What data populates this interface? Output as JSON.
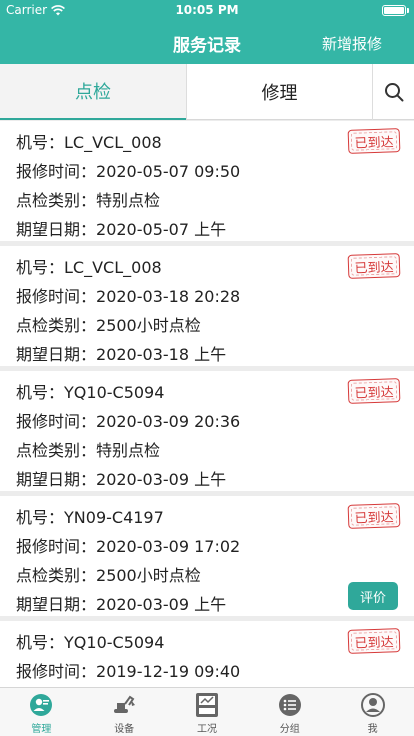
{
  "status_bar": {
    "carrier": "Carrier",
    "time": "10:05 PM"
  },
  "nav": {
    "title": "服务记录",
    "right_button": "新增报修"
  },
  "tabs": [
    {
      "label": "点检",
      "active": true
    },
    {
      "label": "修理",
      "active": false
    }
  ],
  "labels": {
    "machine": "机号：",
    "report_time": "报修时间：",
    "inspect_type": "点检类别：",
    "expected_date": "期望日期："
  },
  "records": [
    {
      "machine": "LC_VCL_008",
      "report_time": "2020-05-07 09:50",
      "inspect_type": "特别点检",
      "expected_date": "2020-05-07  上午",
      "stamp": "已到达"
    },
    {
      "machine": "LC_VCL_008",
      "report_time": "2020-03-18 20:28",
      "inspect_type": "2500小时点检",
      "expected_date": "2020-03-18  上午",
      "stamp": "已到达"
    },
    {
      "machine": "YQ10-C5094",
      "report_time": "2020-03-09 20:36",
      "inspect_type": "特别点检",
      "expected_date": "2020-03-09  上午",
      "stamp": "已到达"
    },
    {
      "machine": "YN09-C4197",
      "report_time": "2020-03-09 17:02",
      "inspect_type": "2500小时点检",
      "expected_date": "2020-03-09  上午",
      "stamp": "已到达",
      "action": "评价"
    },
    {
      "machine": "YQ10-C5094",
      "report_time": "2019-12-19 09:40",
      "stamp": "已到达"
    }
  ],
  "tab_bar": [
    {
      "label": "管理",
      "icon": "manage-icon",
      "active": true
    },
    {
      "label": "设备",
      "icon": "excavator-icon",
      "active": false
    },
    {
      "label": "工况",
      "icon": "gauge-icon",
      "active": false
    },
    {
      "label": "分组",
      "icon": "list-icon",
      "active": false
    },
    {
      "label": "我",
      "icon": "user-icon",
      "active": false
    }
  ],
  "colors": {
    "primary": "#34b6a6",
    "accent": "#2fa89a",
    "stamp": "#d63a3a"
  }
}
